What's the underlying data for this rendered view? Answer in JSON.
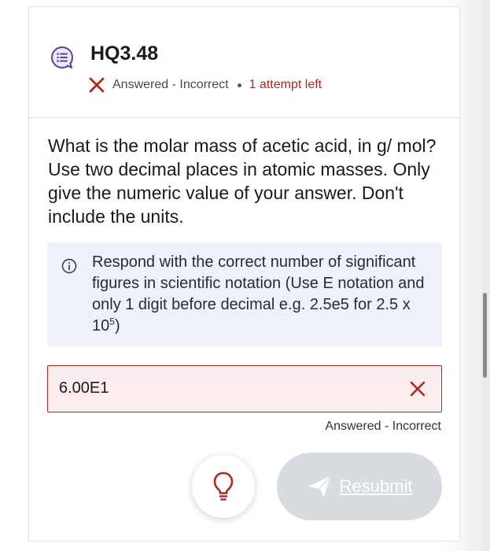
{
  "question": {
    "id": "HQ3.48",
    "status": "Answered - Incorrect",
    "attempts_left": "1 attempt left",
    "prompt": "What is the molar mass of acetic acid, in g/ mol? Use two decimal places in atomic masses. Only give the numeric value of your answer. Don't include the units."
  },
  "hint": {
    "text": "Respond with the correct number of significant figures in scientific notation (Use E notation and only 1 digit before decimal e.g. 2.5e5 for 2.5 x 10",
    "exponent": "5",
    "close": ")"
  },
  "answer": {
    "value": "6.00E1",
    "status": "Answered - Incorrect"
  },
  "actions": {
    "resubmit_label": "Resubmit"
  },
  "colors": {
    "error": "#b3261e",
    "hint_bg": "#eef1fb",
    "question_icon": "#5b3fa5",
    "resubmit_bg": "#d8dbe0"
  },
  "icons": {
    "question": "question-list-icon",
    "incorrect": "close-icon",
    "info": "info-icon",
    "hint": "lightbulb-icon",
    "submit": "send-icon"
  }
}
